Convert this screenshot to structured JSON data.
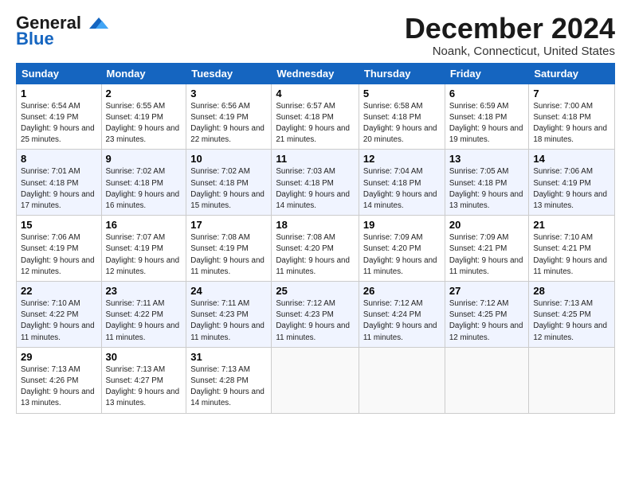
{
  "header": {
    "logo_general": "General",
    "logo_blue": "Blue",
    "title": "December 2024",
    "location": "Noank, Connecticut, United States"
  },
  "days_of_week": [
    "Sunday",
    "Monday",
    "Tuesday",
    "Wednesday",
    "Thursday",
    "Friday",
    "Saturday"
  ],
  "weeks": [
    [
      {
        "day": "1",
        "sunrise": "Sunrise: 6:54 AM",
        "sunset": "Sunset: 4:19 PM",
        "daylight": "Daylight: 9 hours and 25 minutes."
      },
      {
        "day": "2",
        "sunrise": "Sunrise: 6:55 AM",
        "sunset": "Sunset: 4:19 PM",
        "daylight": "Daylight: 9 hours and 23 minutes."
      },
      {
        "day": "3",
        "sunrise": "Sunrise: 6:56 AM",
        "sunset": "Sunset: 4:19 PM",
        "daylight": "Daylight: 9 hours and 22 minutes."
      },
      {
        "day": "4",
        "sunrise": "Sunrise: 6:57 AM",
        "sunset": "Sunset: 4:18 PM",
        "daylight": "Daylight: 9 hours and 21 minutes."
      },
      {
        "day": "5",
        "sunrise": "Sunrise: 6:58 AM",
        "sunset": "Sunset: 4:18 PM",
        "daylight": "Daylight: 9 hours and 20 minutes."
      },
      {
        "day": "6",
        "sunrise": "Sunrise: 6:59 AM",
        "sunset": "Sunset: 4:18 PM",
        "daylight": "Daylight: 9 hours and 19 minutes."
      },
      {
        "day": "7",
        "sunrise": "Sunrise: 7:00 AM",
        "sunset": "Sunset: 4:18 PM",
        "daylight": "Daylight: 9 hours and 18 minutes."
      }
    ],
    [
      {
        "day": "8",
        "sunrise": "Sunrise: 7:01 AM",
        "sunset": "Sunset: 4:18 PM",
        "daylight": "Daylight: 9 hours and 17 minutes."
      },
      {
        "day": "9",
        "sunrise": "Sunrise: 7:02 AM",
        "sunset": "Sunset: 4:18 PM",
        "daylight": "Daylight: 9 hours and 16 minutes."
      },
      {
        "day": "10",
        "sunrise": "Sunrise: 7:02 AM",
        "sunset": "Sunset: 4:18 PM",
        "daylight": "Daylight: 9 hours and 15 minutes."
      },
      {
        "day": "11",
        "sunrise": "Sunrise: 7:03 AM",
        "sunset": "Sunset: 4:18 PM",
        "daylight": "Daylight: 9 hours and 14 minutes."
      },
      {
        "day": "12",
        "sunrise": "Sunrise: 7:04 AM",
        "sunset": "Sunset: 4:18 PM",
        "daylight": "Daylight: 9 hours and 14 minutes."
      },
      {
        "day": "13",
        "sunrise": "Sunrise: 7:05 AM",
        "sunset": "Sunset: 4:18 PM",
        "daylight": "Daylight: 9 hours and 13 minutes."
      },
      {
        "day": "14",
        "sunrise": "Sunrise: 7:06 AM",
        "sunset": "Sunset: 4:19 PM",
        "daylight": "Daylight: 9 hours and 13 minutes."
      }
    ],
    [
      {
        "day": "15",
        "sunrise": "Sunrise: 7:06 AM",
        "sunset": "Sunset: 4:19 PM",
        "daylight": "Daylight: 9 hours and 12 minutes."
      },
      {
        "day": "16",
        "sunrise": "Sunrise: 7:07 AM",
        "sunset": "Sunset: 4:19 PM",
        "daylight": "Daylight: 9 hours and 12 minutes."
      },
      {
        "day": "17",
        "sunrise": "Sunrise: 7:08 AM",
        "sunset": "Sunset: 4:19 PM",
        "daylight": "Daylight: 9 hours and 11 minutes."
      },
      {
        "day": "18",
        "sunrise": "Sunrise: 7:08 AM",
        "sunset": "Sunset: 4:20 PM",
        "daylight": "Daylight: 9 hours and 11 minutes."
      },
      {
        "day": "19",
        "sunrise": "Sunrise: 7:09 AM",
        "sunset": "Sunset: 4:20 PM",
        "daylight": "Daylight: 9 hours and 11 minutes."
      },
      {
        "day": "20",
        "sunrise": "Sunrise: 7:09 AM",
        "sunset": "Sunset: 4:21 PM",
        "daylight": "Daylight: 9 hours and 11 minutes."
      },
      {
        "day": "21",
        "sunrise": "Sunrise: 7:10 AM",
        "sunset": "Sunset: 4:21 PM",
        "daylight": "Daylight: 9 hours and 11 minutes."
      }
    ],
    [
      {
        "day": "22",
        "sunrise": "Sunrise: 7:10 AM",
        "sunset": "Sunset: 4:22 PM",
        "daylight": "Daylight: 9 hours and 11 minutes."
      },
      {
        "day": "23",
        "sunrise": "Sunrise: 7:11 AM",
        "sunset": "Sunset: 4:22 PM",
        "daylight": "Daylight: 9 hours and 11 minutes."
      },
      {
        "day": "24",
        "sunrise": "Sunrise: 7:11 AM",
        "sunset": "Sunset: 4:23 PM",
        "daylight": "Daylight: 9 hours and 11 minutes."
      },
      {
        "day": "25",
        "sunrise": "Sunrise: 7:12 AM",
        "sunset": "Sunset: 4:23 PM",
        "daylight": "Daylight: 9 hours and 11 minutes."
      },
      {
        "day": "26",
        "sunrise": "Sunrise: 7:12 AM",
        "sunset": "Sunset: 4:24 PM",
        "daylight": "Daylight: 9 hours and 11 minutes."
      },
      {
        "day": "27",
        "sunrise": "Sunrise: 7:12 AM",
        "sunset": "Sunset: 4:25 PM",
        "daylight": "Daylight: 9 hours and 12 minutes."
      },
      {
        "day": "28",
        "sunrise": "Sunrise: 7:13 AM",
        "sunset": "Sunset: 4:25 PM",
        "daylight": "Daylight: 9 hours and 12 minutes."
      }
    ],
    [
      {
        "day": "29",
        "sunrise": "Sunrise: 7:13 AM",
        "sunset": "Sunset: 4:26 PM",
        "daylight": "Daylight: 9 hours and 13 minutes."
      },
      {
        "day": "30",
        "sunrise": "Sunrise: 7:13 AM",
        "sunset": "Sunset: 4:27 PM",
        "daylight": "Daylight: 9 hours and 13 minutes."
      },
      {
        "day": "31",
        "sunrise": "Sunrise: 7:13 AM",
        "sunset": "Sunset: 4:28 PM",
        "daylight": "Daylight: 9 hours and 14 minutes."
      },
      null,
      null,
      null,
      null
    ]
  ]
}
